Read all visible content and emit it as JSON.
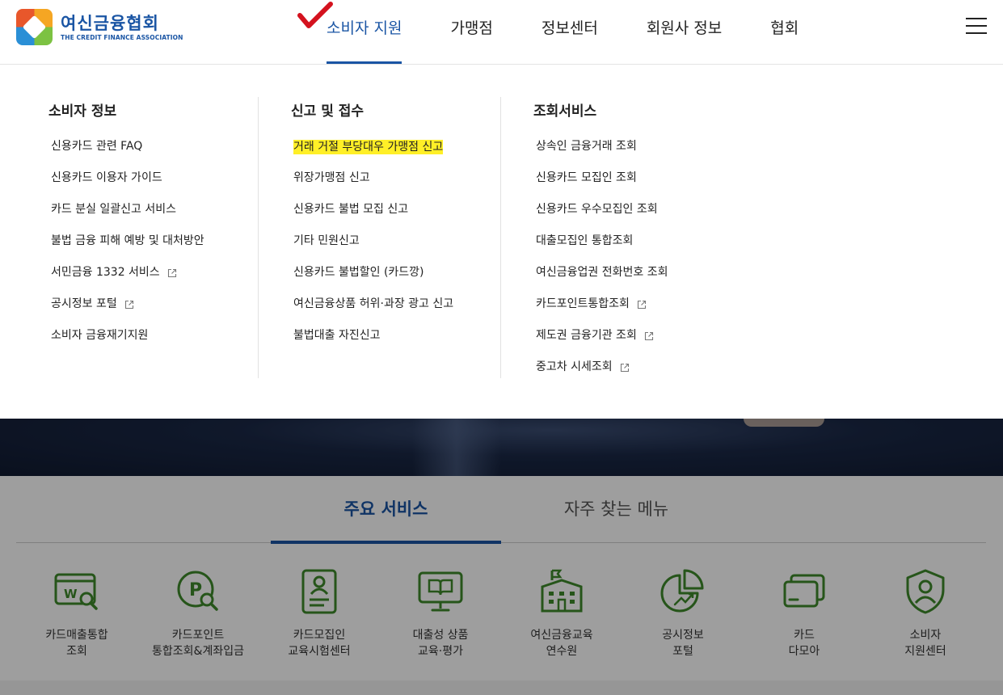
{
  "brand": {
    "name_ko": "여신금융협회",
    "name_en": "THE CREDIT FINANCE ASSOCIATION"
  },
  "nav": {
    "items": [
      {
        "label": "소비자 지원",
        "active": true
      },
      {
        "label": "가맹점"
      },
      {
        "label": "정보센터"
      },
      {
        "label": "회원사 정보"
      },
      {
        "label": "협회"
      }
    ]
  },
  "dropdown": {
    "columns": [
      {
        "title": "소비자 정보",
        "items": [
          {
            "label": "신용카드 관련 FAQ"
          },
          {
            "label": "신용카드 이용자 가이드"
          },
          {
            "label": "카드 분실 일괄신고 서비스"
          },
          {
            "label": "불법 금융 피해 예방 및 대처방안"
          },
          {
            "label": "서민금융 1332 서비스",
            "external": true
          },
          {
            "label": "공시정보 포털",
            "external": true
          },
          {
            "label": "소비자 금융재기지원"
          }
        ]
      },
      {
        "title": "신고 및 접수",
        "items": [
          {
            "label": "거래 거절 부당대우 가맹점 신고",
            "highlighted": true
          },
          {
            "label": "위장가맹점 신고"
          },
          {
            "label": "신용카드 불법 모집 신고"
          },
          {
            "label": "기타 민원신고"
          },
          {
            "label": "신용카드 불법할인 (카드깡)"
          },
          {
            "label": "여신금융상품 허위·과장 광고 신고"
          },
          {
            "label": "불법대출 자진신고"
          }
        ]
      },
      {
        "title": "조회서비스",
        "items": [
          {
            "label": "상속인 금융거래 조회"
          },
          {
            "label": "신용카드 모집인 조회"
          },
          {
            "label": "신용카드 우수모집인 조회"
          },
          {
            "label": "대출모집인 통합조회"
          },
          {
            "label": "여신금융업권 전화번호 조회"
          },
          {
            "label": "카드포인트통합조회",
            "external": true
          },
          {
            "label": "제도권 금융기관 조회",
            "external": true
          },
          {
            "label": "중고차 시세조회",
            "external": true
          }
        ]
      }
    ]
  },
  "services": {
    "tabs": [
      {
        "label": "주요 서비스",
        "active": true
      },
      {
        "label": "자주 찾는 메뉴"
      }
    ],
    "items": [
      {
        "line1": "카드매출통합",
        "line2": "조회",
        "icon": "card-sales-search-icon"
      },
      {
        "line1": "카드포인트",
        "line2": "통합조회&계좌입금",
        "icon": "point-search-icon"
      },
      {
        "line1": "카드모집인",
        "line2": "교육시험센터",
        "icon": "recruiter-document-icon"
      },
      {
        "line1": "대출성 상품",
        "line2": "교육·평가",
        "icon": "book-monitor-icon"
      },
      {
        "line1": "여신금융교육",
        "line2": "연수원",
        "icon": "school-building-icon"
      },
      {
        "line1": "공시정보",
        "line2": "포털",
        "icon": "pie-chart-icon"
      },
      {
        "line1": "카드",
        "line2": "다모아",
        "icon": "cards-stack-icon"
      },
      {
        "line1": "소비자",
        "line2": "지원센터",
        "icon": "shield-user-icon"
      }
    ]
  },
  "colors": {
    "brand_blue": "#1a55a4",
    "icon_green": "#3e8a2b",
    "highlight": "#ffef27",
    "check_red": "#d4121e"
  }
}
